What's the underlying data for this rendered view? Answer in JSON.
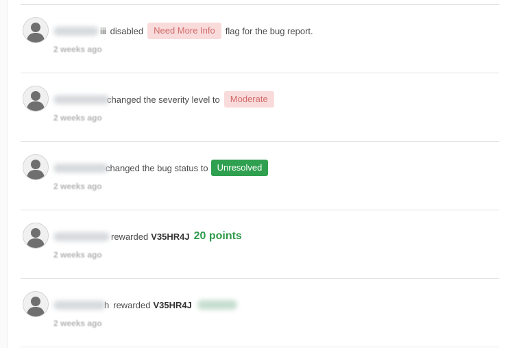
{
  "activity": [
    {
      "user_tail": "iii",
      "action": "disabled",
      "badge": "Need More Info",
      "suffix": "flag for the bug report.",
      "time": "2 weeks ago"
    },
    {
      "user_tail": "",
      "action": "changed the severity level to",
      "badge": "Moderate",
      "time": "2 weeks ago"
    },
    {
      "user_tail": "",
      "action": "changed the bug status to",
      "badge": "Unresolved",
      "time": "2 weeks ago"
    },
    {
      "user_tail": "",
      "action": "rewarded",
      "code": "V35HR4J",
      "points": "20 points",
      "time": "2 weeks ago"
    },
    {
      "user_tail": "h",
      "action": "rewarded",
      "code": "V35HR4J",
      "time": "2 weeks ago"
    }
  ],
  "colors": {
    "pink_badge_bg": "#fadbdb",
    "pink_badge_text": "#d06a6a",
    "green_badge_bg": "#2ea04f",
    "points_text": "#2e9a4c"
  },
  "icons": {
    "avatar": "user-silhouette-icon"
  }
}
